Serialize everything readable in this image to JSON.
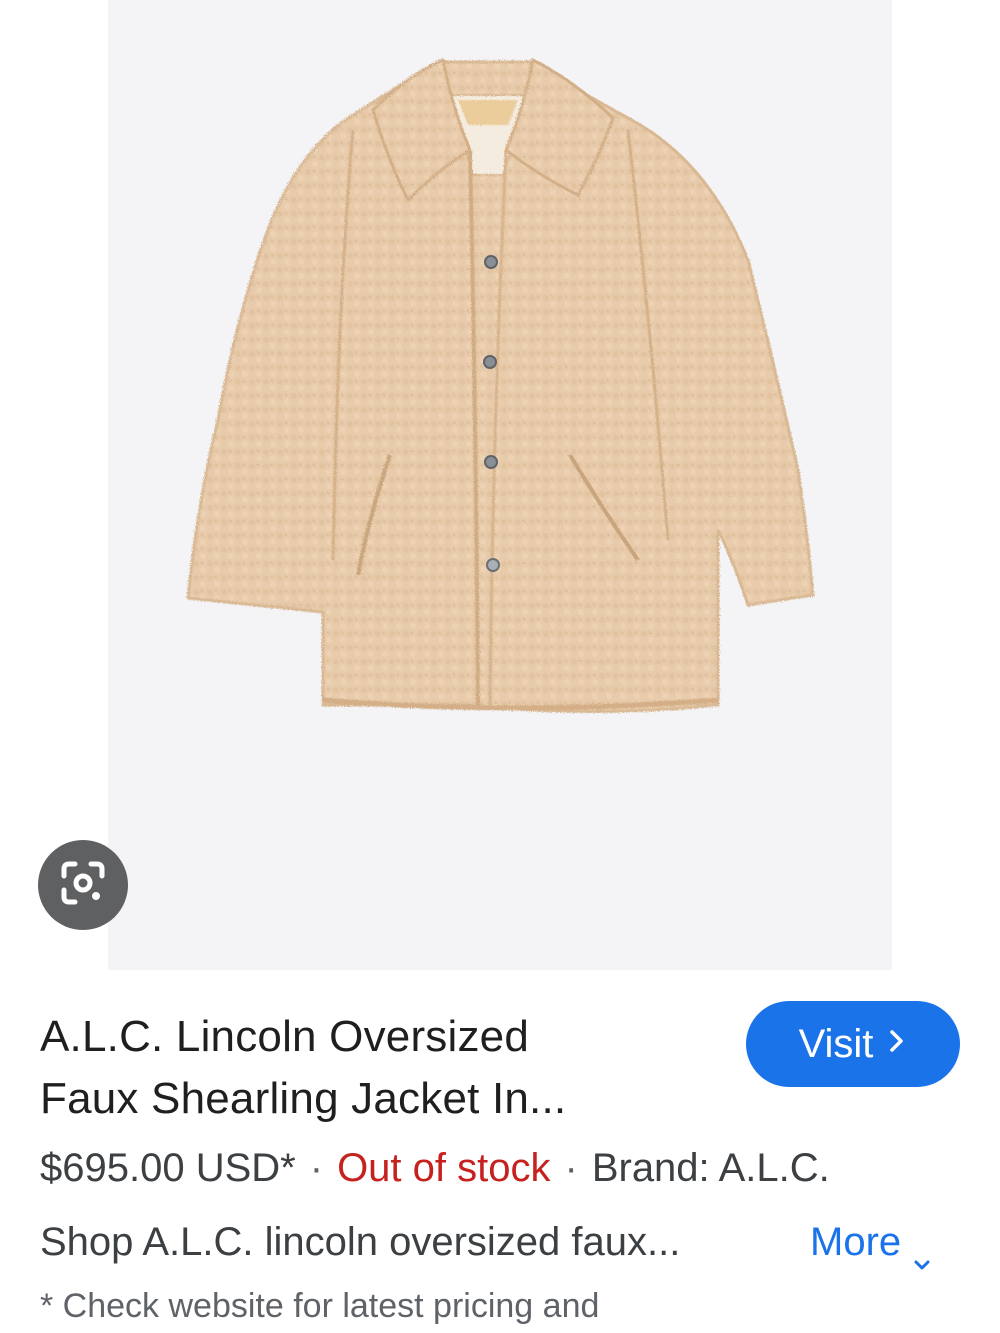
{
  "product": {
    "title_line1": "A.L.C. Lincoln Oversized",
    "title_line2": "Faux Shearling Jacket In...",
    "price": "$695.00 USD*",
    "separator": "·",
    "stock_status": "Out of stock",
    "brand": "Brand: A.L.C.",
    "description": "Shop A.L.C. lincoln oversized faux...",
    "footnote": "* Check website for latest pricing and"
  },
  "actions": {
    "visit_label": "Visit",
    "more_label": "More"
  },
  "icons": {
    "lens": "google-lens-icon",
    "visit_chevron": "chevron-right-icon",
    "more_chevron": "chevron-down-icon"
  },
  "colors": {
    "accent": "#1a73e8",
    "out_of_stock": "#c5221f",
    "jacket": "#e6c9a6",
    "image_background": "#f4f4f6"
  }
}
